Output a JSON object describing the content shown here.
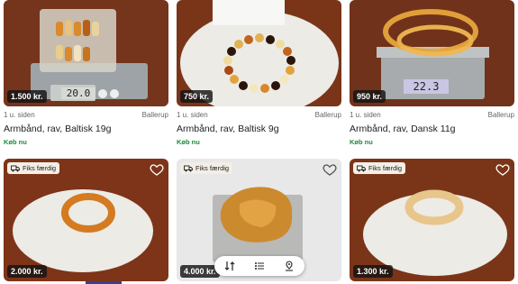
{
  "listings": [
    {
      "price": "1.500 kr.",
      "time": "1 u. siden",
      "location": "Ballerup",
      "title": "Armbånd, rav, Baltisk 19g",
      "buy_now": "Køb nu",
      "scale": "20.0"
    },
    {
      "price": "750 kr.",
      "time": "1 u. siden",
      "location": "Ballerup",
      "title": "Armbånd, rav, Baltisk 9g",
      "buy_now": "Køb nu"
    },
    {
      "price": "950 kr.",
      "time": "1 u. siden",
      "location": "Ballerup",
      "title": "Armbånd, rav, Dansk 11g",
      "buy_now": "Køb nu",
      "scale": "22.3"
    },
    {
      "price": "2.000 kr.",
      "badge": "Fiks færdig"
    },
    {
      "price": "4.000 kr.",
      "badge": "Fiks færdig"
    },
    {
      "price": "1.300 kr.",
      "badge": "Fiks færdig"
    }
  ],
  "colors": {
    "buy_now": "#1e8a3c",
    "price_bg": "#141414",
    "scroll_indicator": "#3a3f8f"
  },
  "icons": [
    "heart-icon",
    "truck-icon",
    "sort-icon",
    "list-icon",
    "map-pin-icon"
  ]
}
